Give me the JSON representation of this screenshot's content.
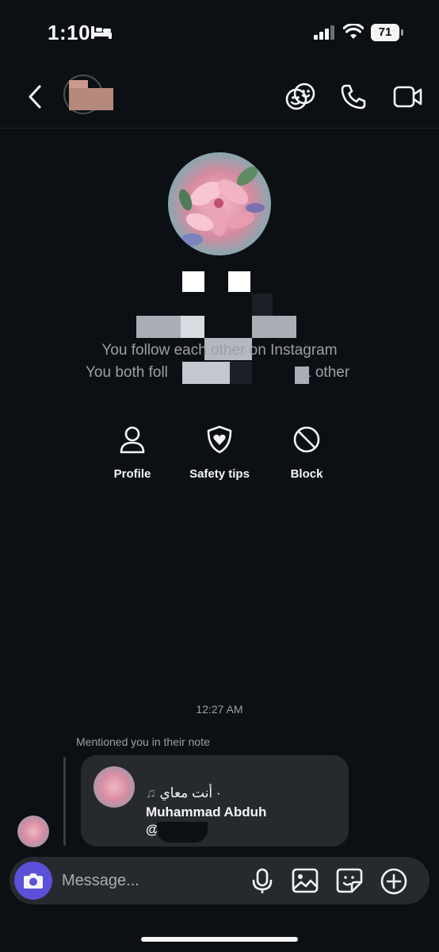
{
  "status_bar": {
    "time": "1:10",
    "battery": "71"
  },
  "thread": {
    "follow_line_1": "You follow each other on Instagram",
    "follow_line_2": "You both foll",
    "follow_line_2_tail": "1 other",
    "actions": [
      {
        "label": "Profile",
        "icon": "user-icon"
      },
      {
        "label": "Safety tips",
        "icon": "shield-heart-icon"
      },
      {
        "label": "Block",
        "icon": "block-icon"
      }
    ],
    "timestamp": "12:27 AM",
    "mention_label": "Mentioned you in their note",
    "note": {
      "song": "أنت معاي ·",
      "artist": "Muhammad Abduh",
      "handle": "@"
    }
  },
  "composer": {
    "placeholder": "Message..."
  },
  "colors": {
    "background": "#0c1014",
    "card": "#262a2f",
    "accent": "#5b51d8",
    "muted_text": "#9aa0a6"
  }
}
